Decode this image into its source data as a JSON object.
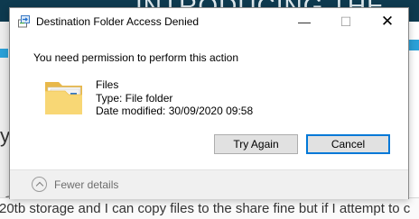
{
  "background_page": {
    "header_text": "INTRODUCING THE",
    "left_fragment": "y",
    "bottom_left_fragment": "C",
    "bottom_text": "20tb storage and I can copy files to the share fine but if I attempt to c"
  },
  "dialog": {
    "title": "Destination Folder Access Denied",
    "minimize_glyph": "—",
    "maximize_glyph": "☐",
    "close_glyph": "✕",
    "heading": "You need permission to perform this action",
    "item": {
      "name": "Files",
      "type": "Type: File folder",
      "modified": "Date modified: 30/09/2020 09:58"
    },
    "buttons": {
      "try_again": "Try Again",
      "cancel": "Cancel"
    },
    "footer": {
      "details_label": "Fewer details"
    },
    "icons": {
      "app": "file-transfer-icon",
      "item": "folder-icon",
      "expander": "chevron-up-icon"
    },
    "colors": {
      "accent": "#0078d7",
      "folder": "#f8d775",
      "footer_bg": "#f0f0f0"
    }
  }
}
